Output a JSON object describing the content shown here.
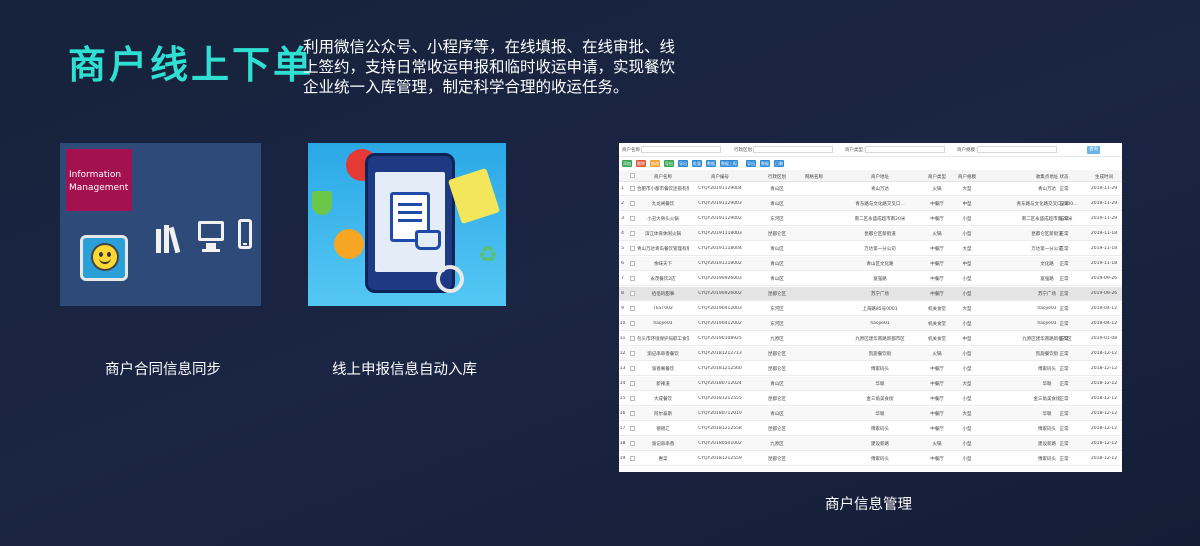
{
  "header": {
    "title": "商户线上下单",
    "description": "利用微信公众号、小程序等，在线填报、在线审批、线上签约，支持日常收运申报和临时收运申请，实现餐饮企业统一入库管理，制定科学合理的收运任务。"
  },
  "cards": [
    {
      "caption": "商户合同信息同步",
      "info_label": "Information Management"
    },
    {
      "caption": "线上申报信息自动入库"
    },
    {
      "caption": "商户信息管理"
    }
  ],
  "table_ui": {
    "filters": [
      "商户名称：",
      "行政区划：",
      "商户类型：",
      "商户规模："
    ],
    "query_button": "查询",
    "toolbar": [
      {
        "label": "添加",
        "color": "#3aa655"
      },
      {
        "label": "删除",
        "color": "#e05a3c"
      },
      {
        "label": "修改",
        "color": "#f0a33a"
      },
      {
        "label": "导出",
        "color": "#3aa655"
      },
      {
        "label": "导出",
        "color": "#2f8ad6"
      },
      {
        "label": "批量",
        "color": "#2f8ad6"
      },
      {
        "label": "数据",
        "color": "#2f8ad6"
      },
      {
        "label": "数据上报",
        "color": "#2f8ad6"
      },
      {
        "label": "导出",
        "color": "#2f8ad6"
      },
      {
        "label": "数据",
        "color": "#2f8ad6"
      },
      {
        "label": "已删",
        "color": "#2f8ad6"
      }
    ],
    "columns": [
      "商户名称",
      "商户编号",
      "行政区划",
      "网格名称",
      "商户地址",
      "商户类型",
      "商户规模",
      "收集点地址",
      "状态",
      "生成时间"
    ],
    "rows": [
      [
        "合肥市小都市餐饮连锁有限公司包头万达广场",
        "CYQY20191129004",
        "青山区",
        "",
        "青山万达",
        "火锅",
        "大型",
        "青山万达",
        "正常",
        "2019-11-29"
      ],
      [
        "九龙闸餐饮",
        "CYQY20191129003",
        "青山区",
        "",
        "青东路与文化路交叉口...",
        "中餐厅",
        "中型",
        "青东路与文化路交叉口2000...",
        "正常",
        "2019-11-29"
      ],
      [
        "小丑大骨头火锅",
        "CYQY20191129002",
        "东河区",
        "",
        "南二区永盛成超市南20米",
        "中餐厅",
        "小型",
        "南二区永盛成超市南20米",
        "正常",
        "2019-11-29"
      ],
      [
        "滨江体育休闲火锅",
        "CYQY20191118003",
        "昆都仑区",
        "",
        "昆都仑区新街道",
        "火锅",
        "小型",
        "昆都仑区新街道",
        "正常",
        "2019-11-18"
      ],
      [
        "青山万达青岛餐饮管理有限公司",
        "CYQY20191118004",
        "青山区",
        "",
        "万达第一分公司",
        "中餐厅",
        "大型",
        "万达第一分公司",
        "正常",
        "2019-11-18"
      ],
      [
        "余味天下",
        "CYQY20191118002",
        "青山区",
        "",
        "青山区文化路",
        "中餐厅",
        "中型",
        "文化路",
        "正常",
        "2019-11-18"
      ],
      [
        "永茂餐饮2店",
        "CYQY20190926003",
        "青山区",
        "",
        "富强路",
        "中餐厅",
        "小型",
        "富强路",
        "正常",
        "2019-09-26"
      ],
      [
        "佰佰的甜事",
        "CYQY20190926002",
        "昆都仑区",
        "",
        "苏宁广场",
        "中餐厅",
        "小型",
        "苏宁广场",
        "正常",
        "2019-09-26"
      ],
      [
        "TEST002",
        "CYQY20190412003",
        "东河区",
        "",
        "上海路85号0001",
        "机关食堂",
        "大型",
        "haojie01",
        "正常",
        "2019-04-12"
      ],
      [
        "haojie01",
        "CYQY20190412002",
        "东河区",
        "",
        "haojie01",
        "机关食堂",
        "小型",
        "haojie01",
        "正常",
        "2019-04-12"
      ],
      [
        "包头市环境保护局职工食堂",
        "CYQY20190108925",
        "九原区",
        "",
        "九原区建华南路新都市区",
        "机关食堂",
        "中型",
        "九原区建华南路新都市区",
        "正常",
        "2019-01-08"
      ],
      [
        "渝记串串香餐饮",
        "CYQY20181212713",
        "昆都仑区",
        "",
        "凯旋餐饮街",
        "火锅",
        "小型",
        "凯旋餐饮街",
        "正常",
        "2018-12-12"
      ],
      [
        "渝香阁餐饮",
        "CYQY20181212560",
        "昆都仑区",
        "",
        "傅家码头",
        "中餐厅",
        "小型",
        "傅家码头",
        "正常",
        "2018-12-12"
      ],
      [
        "新辣道",
        "CYQY20180712024",
        "青山区",
        "",
        "华联",
        "中餐厅",
        "大型",
        "华联",
        "正常",
        "2018-12-12"
      ],
      [
        "大成餐饮",
        "CYQY20181212555",
        "昆都仑区",
        "",
        "金三角美食街",
        "中餐厅",
        "小型",
        "金三角美食街",
        "正常",
        "2018-12-12"
      ],
      [
        "阿尔泰斯",
        "CYQY20180712010",
        "青山区",
        "",
        "华联",
        "中餐厅",
        "大型",
        "华联",
        "正常",
        "2018-12-12"
      ],
      [
        "德刚汇",
        "CYQY20181212558",
        "昆都仑区",
        "",
        "傅家码头",
        "中餐厅",
        "小型",
        "傅家码头",
        "正常",
        "2018-12-12"
      ],
      [
        "渝记串串香",
        "CYQY20180501002",
        "九原区",
        "",
        "建设新路",
        "火锅",
        "小型",
        "建设新路",
        "正常",
        "2018-12-12"
      ],
      [
        "惠菜",
        "CYQY20181212559",
        "昆都仑区",
        "",
        "傅家码头",
        "中餐厅",
        "小型",
        "傅家码头",
        "正常",
        "2018-12-12"
      ]
    ]
  }
}
